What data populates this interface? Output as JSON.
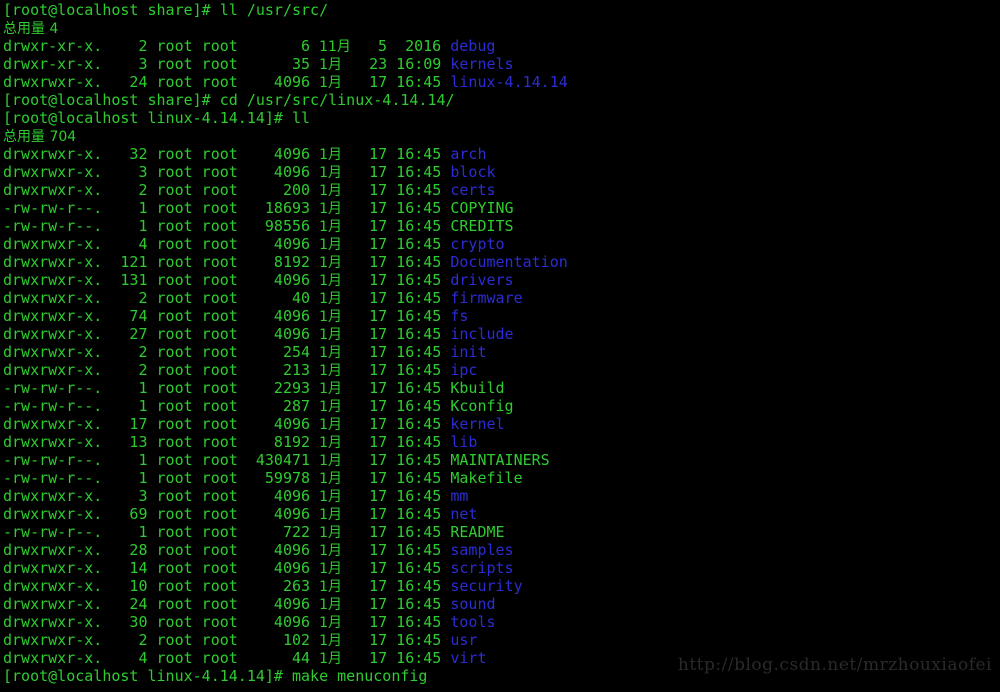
{
  "terminal": {
    "title": "root@localhost:/usr/src/linux-4.14.14",
    "colors": {
      "background": "#000000",
      "foreground": "#2fcc2f",
      "directory": "#2c2cd4",
      "file": "#2fcc2f",
      "watermark": "#2a2a2a"
    },
    "user": "root",
    "host": "localhost",
    "prompt_symbol": "#",
    "month_label_jan": "1月",
    "month_label_nov": "11月",
    "total_label": "总用量"
  },
  "session": [
    {
      "type": "prompt",
      "name": "prompt-line-1",
      "prompt": "[root@localhost share]#",
      "command": " ll /usr/src/"
    },
    {
      "type": "total",
      "name": "total-line-1",
      "text": "总用量 4"
    },
    {
      "type": "listing",
      "name": "listing-debug",
      "perms": "drwxr-xr-x.",
      "links": "2",
      "owner": "root",
      "group": "root",
      "size": "6",
      "month": "11月",
      "day": "5",
      "time": "2016",
      "filename": "debug",
      "kind": "dir"
    },
    {
      "type": "listing",
      "name": "listing-kernels",
      "perms": "drwxr-xr-x.",
      "links": "3",
      "owner": "root",
      "group": "root",
      "size": "35",
      "month": "1月",
      "day": "23",
      "time": "16:09",
      "filename": "kernels",
      "kind": "dir"
    },
    {
      "type": "listing",
      "name": "listing-linux-4-14-14",
      "perms": "drwxrwxr-x.",
      "links": "24",
      "owner": "root",
      "group": "root",
      "size": "4096",
      "month": "1月",
      "day": "17",
      "time": "16:45",
      "filename": "linux-4.14.14",
      "kind": "dir"
    },
    {
      "type": "prompt",
      "name": "prompt-line-2",
      "prompt": "[root@localhost share]#",
      "command": " cd /usr/src/linux-4.14.14/"
    },
    {
      "type": "prompt",
      "name": "prompt-line-3",
      "prompt": "[root@localhost linux-4.14.14]#",
      "command": " ll"
    },
    {
      "type": "total",
      "name": "total-line-2",
      "text": "总用量 704"
    },
    {
      "type": "listing",
      "name": "listing-arch",
      "perms": "drwxrwxr-x.",
      "links": "32",
      "owner": "root",
      "group": "root",
      "size": "4096",
      "month": "1月",
      "day": "17",
      "time": "16:45",
      "filename": "arch",
      "kind": "dir"
    },
    {
      "type": "listing",
      "name": "listing-block",
      "perms": "drwxrwxr-x.",
      "links": "3",
      "owner": "root",
      "group": "root",
      "size": "4096",
      "month": "1月",
      "day": "17",
      "time": "16:45",
      "filename": "block",
      "kind": "dir"
    },
    {
      "type": "listing",
      "name": "listing-certs",
      "perms": "drwxrwxr-x.",
      "links": "2",
      "owner": "root",
      "group": "root",
      "size": "200",
      "month": "1月",
      "day": "17",
      "time": "16:45",
      "filename": "certs",
      "kind": "dir"
    },
    {
      "type": "listing",
      "name": "listing-copying",
      "perms": "-rw-rw-r--.",
      "links": "1",
      "owner": "root",
      "group": "root",
      "size": "18693",
      "month": "1月",
      "day": "17",
      "time": "16:45",
      "filename": "COPYING",
      "kind": "file"
    },
    {
      "type": "listing",
      "name": "listing-credits",
      "perms": "-rw-rw-r--.",
      "links": "1",
      "owner": "root",
      "group": "root",
      "size": "98556",
      "month": "1月",
      "day": "17",
      "time": "16:45",
      "filename": "CREDITS",
      "kind": "file"
    },
    {
      "type": "listing",
      "name": "listing-crypto",
      "perms": "drwxrwxr-x.",
      "links": "4",
      "owner": "root",
      "group": "root",
      "size": "4096",
      "month": "1月",
      "day": "17",
      "time": "16:45",
      "filename": "crypto",
      "kind": "dir"
    },
    {
      "type": "listing",
      "name": "listing-documentation",
      "perms": "drwxrwxr-x.",
      "links": "121",
      "owner": "root",
      "group": "root",
      "size": "8192",
      "month": "1月",
      "day": "17",
      "time": "16:45",
      "filename": "Documentation",
      "kind": "dir"
    },
    {
      "type": "listing",
      "name": "listing-drivers",
      "perms": "drwxrwxr-x.",
      "links": "131",
      "owner": "root",
      "group": "root",
      "size": "4096",
      "month": "1月",
      "day": "17",
      "time": "16:45",
      "filename": "drivers",
      "kind": "dir"
    },
    {
      "type": "listing",
      "name": "listing-firmware",
      "perms": "drwxrwxr-x.",
      "links": "2",
      "owner": "root",
      "group": "root",
      "size": "40",
      "month": "1月",
      "day": "17",
      "time": "16:45",
      "filename": "firmware",
      "kind": "dir"
    },
    {
      "type": "listing",
      "name": "listing-fs",
      "perms": "drwxrwxr-x.",
      "links": "74",
      "owner": "root",
      "group": "root",
      "size": "4096",
      "month": "1月",
      "day": "17",
      "time": "16:45",
      "filename": "fs",
      "kind": "dir"
    },
    {
      "type": "listing",
      "name": "listing-include",
      "perms": "drwxrwxr-x.",
      "links": "27",
      "owner": "root",
      "group": "root",
      "size": "4096",
      "month": "1月",
      "day": "17",
      "time": "16:45",
      "filename": "include",
      "kind": "dir"
    },
    {
      "type": "listing",
      "name": "listing-init",
      "perms": "drwxrwxr-x.",
      "links": "2",
      "owner": "root",
      "group": "root",
      "size": "254",
      "month": "1月",
      "day": "17",
      "time": "16:45",
      "filename": "init",
      "kind": "dir"
    },
    {
      "type": "listing",
      "name": "listing-ipc",
      "perms": "drwxrwxr-x.",
      "links": "2",
      "owner": "root",
      "group": "root",
      "size": "213",
      "month": "1月",
      "day": "17",
      "time": "16:45",
      "filename": "ipc",
      "kind": "dir"
    },
    {
      "type": "listing",
      "name": "listing-kbuild",
      "perms": "-rw-rw-r--.",
      "links": "1",
      "owner": "root",
      "group": "root",
      "size": "2293",
      "month": "1月",
      "day": "17",
      "time": "16:45",
      "filename": "Kbuild",
      "kind": "file"
    },
    {
      "type": "listing",
      "name": "listing-kconfig",
      "perms": "-rw-rw-r--.",
      "links": "1",
      "owner": "root",
      "group": "root",
      "size": "287",
      "month": "1月",
      "day": "17",
      "time": "16:45",
      "filename": "Kconfig",
      "kind": "file"
    },
    {
      "type": "listing",
      "name": "listing-kernel",
      "perms": "drwxrwxr-x.",
      "links": "17",
      "owner": "root",
      "group": "root",
      "size": "4096",
      "month": "1月",
      "day": "17",
      "time": "16:45",
      "filename": "kernel",
      "kind": "dir"
    },
    {
      "type": "listing",
      "name": "listing-lib",
      "perms": "drwxrwxr-x.",
      "links": "13",
      "owner": "root",
      "group": "root",
      "size": "8192",
      "month": "1月",
      "day": "17",
      "time": "16:45",
      "filename": "lib",
      "kind": "dir"
    },
    {
      "type": "listing",
      "name": "listing-maintainers",
      "perms": "-rw-rw-r--.",
      "links": "1",
      "owner": "root",
      "group": "root",
      "size": "430471",
      "month": "1月",
      "day": "17",
      "time": "16:45",
      "filename": "MAINTAINERS",
      "kind": "file"
    },
    {
      "type": "listing",
      "name": "listing-makefile",
      "perms": "-rw-rw-r--.",
      "links": "1",
      "owner": "root",
      "group": "root",
      "size": "59978",
      "month": "1月",
      "day": "17",
      "time": "16:45",
      "filename": "Makefile",
      "kind": "file"
    },
    {
      "type": "listing",
      "name": "listing-mm",
      "perms": "drwxrwxr-x.",
      "links": "3",
      "owner": "root",
      "group": "root",
      "size": "4096",
      "month": "1月",
      "day": "17",
      "time": "16:45",
      "filename": "mm",
      "kind": "dir"
    },
    {
      "type": "listing",
      "name": "listing-net",
      "perms": "drwxrwxr-x.",
      "links": "69",
      "owner": "root",
      "group": "root",
      "size": "4096",
      "month": "1月",
      "day": "17",
      "time": "16:45",
      "filename": "net",
      "kind": "dir"
    },
    {
      "type": "listing",
      "name": "listing-readme",
      "perms": "-rw-rw-r--.",
      "links": "1",
      "owner": "root",
      "group": "root",
      "size": "722",
      "month": "1月",
      "day": "17",
      "time": "16:45",
      "filename": "README",
      "kind": "file"
    },
    {
      "type": "listing",
      "name": "listing-samples",
      "perms": "drwxrwxr-x.",
      "links": "28",
      "owner": "root",
      "group": "root",
      "size": "4096",
      "month": "1月",
      "day": "17",
      "time": "16:45",
      "filename": "samples",
      "kind": "dir"
    },
    {
      "type": "listing",
      "name": "listing-scripts",
      "perms": "drwxrwxr-x.",
      "links": "14",
      "owner": "root",
      "group": "root",
      "size": "4096",
      "month": "1月",
      "day": "17",
      "time": "16:45",
      "filename": "scripts",
      "kind": "dir"
    },
    {
      "type": "listing",
      "name": "listing-security",
      "perms": "drwxrwxr-x.",
      "links": "10",
      "owner": "root",
      "group": "root",
      "size": "263",
      "month": "1月",
      "day": "17",
      "time": "16:45",
      "filename": "security",
      "kind": "dir"
    },
    {
      "type": "listing",
      "name": "listing-sound",
      "perms": "drwxrwxr-x.",
      "links": "24",
      "owner": "root",
      "group": "root",
      "size": "4096",
      "month": "1月",
      "day": "17",
      "time": "16:45",
      "filename": "sound",
      "kind": "dir"
    },
    {
      "type": "listing",
      "name": "listing-tools",
      "perms": "drwxrwxr-x.",
      "links": "30",
      "owner": "root",
      "group": "root",
      "size": "4096",
      "month": "1月",
      "day": "17",
      "time": "16:45",
      "filename": "tools",
      "kind": "dir"
    },
    {
      "type": "listing",
      "name": "listing-usr",
      "perms": "drwxrwxr-x.",
      "links": "2",
      "owner": "root",
      "group": "root",
      "size": "102",
      "month": "1月",
      "day": "17",
      "time": "16:45",
      "filename": "usr",
      "kind": "dir"
    },
    {
      "type": "listing",
      "name": "listing-virt",
      "perms": "drwxrwxr-x.",
      "links": "4",
      "owner": "root",
      "group": "root",
      "size": "44",
      "month": "1月",
      "day": "17",
      "time": "16:45",
      "filename": "virt",
      "kind": "dir"
    },
    {
      "type": "prompt",
      "name": "prompt-line-4",
      "prompt": "[root@localhost linux-4.14.14]#",
      "command": " make menuconfig"
    }
  ],
  "watermark": {
    "text": "http://blog.csdn.net/mrzhouxiaofei"
  }
}
